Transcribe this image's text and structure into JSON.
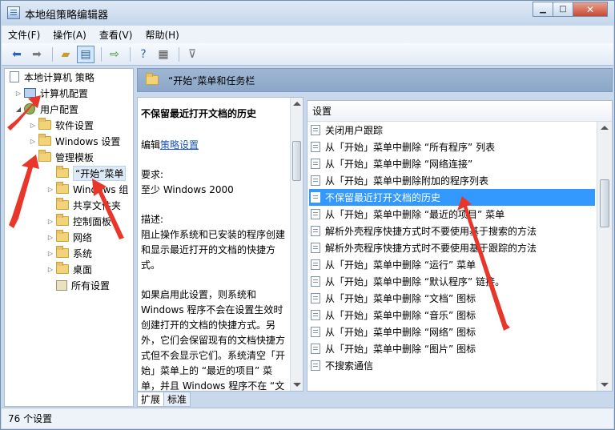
{
  "window": {
    "title": "本地组策略编辑器"
  },
  "menu": [
    "文件(F)",
    "操作(A)",
    "查看(V)",
    "帮助(H)"
  ],
  "tree": {
    "root": "本地计算机 策略",
    "computer_config": "计算机配置",
    "user_config": "用户配置",
    "software_settings": "软件设置",
    "windows_settings": "Windows 设置",
    "admin_templates": "管理模板",
    "start_menu": "“开始”菜单",
    "windows_components": "Windows 组",
    "shared_folders": "共享文件夹",
    "control_panel": "控制面板",
    "network": "网络",
    "system": "系统",
    "desktop": "桌面",
    "all_settings": "所有设置"
  },
  "header": {
    "title": "“开始”菜单和任务栏"
  },
  "description": {
    "title": "不保留最近打开文档的历史",
    "edit_prefix": "编辑",
    "edit_link": "策略设置",
    "requirements_label": "要求:",
    "requirements": "至少 Windows 2000",
    "desc_label": "描述:",
    "desc_text": "阻止操作系统和已安装的程序创建和显示最近打开的文档的快捷方式。",
    "detail_text": "如果启用此设置，则系统和 Windows 程序不会在设置生效时创建打开的文档的快捷方式。另外，它们会保留现有的文档快捷方式但不会显示它们。系统清空「开始」菜单上的 “最近的项目” 菜单，并且 Windows 程序不在 “文"
  },
  "settings_list": {
    "header": "设置",
    "items": [
      "关闭用户跟踪",
      "从「开始」菜单中删除 “所有程序” 列表",
      "从「开始」菜单中删除 “网络连接”",
      "从「开始」菜单中删除附加的程序列表",
      "不保留最近打开文档的历史",
      "从「开始」菜单中删除 “最近的项目” 菜单",
      "解析外壳程序快捷方式时不要使用基于搜索的方法",
      "解析外壳程序快捷方式时不要使用基于跟踪的方法",
      "从「开始」菜单中删除 “运行” 菜单",
      "从「开始」菜单中删除 “默认程序” 链接。",
      "从「开始」菜单中删除 “文档” 图标",
      "从「开始」菜单中删除 “音乐” 图标",
      "从「开始」菜单中删除 “网络” 图标",
      "从「开始」菜单中删除 “图片” 图标",
      "不搜索通信"
    ],
    "selected_index": 4
  },
  "tabs": [
    "扩展",
    "标准"
  ],
  "status": {
    "text": "76 个设置"
  }
}
